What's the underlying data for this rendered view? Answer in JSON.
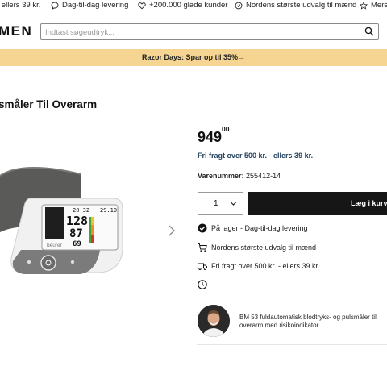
{
  "usp_bar": {
    "items": [
      {
        "label": "- ellers 39 kr.",
        "icon": "truck-icon"
      },
      {
        "label": "Dag-til-dag levering",
        "icon": "chat-bubble-icon"
      },
      {
        "label": "+200.000 glade kunder",
        "icon": "heart-icon"
      },
      {
        "label": "Nordens største udvalg til mænd",
        "icon": "verified-badge-icon"
      },
      {
        "label": "Mere",
        "icon": "star-icon"
      }
    ]
  },
  "header": {
    "logo_text": "MEN",
    "search_placeholder": "Indtast søgeudtryk...",
    "search_icon": "search-icon"
  },
  "promo": {
    "text": "Razor Days: Spar op til 35%→",
    "color": "#f6d592"
  },
  "product": {
    "title": "småler Til Overarm",
    "price_main": "949",
    "price_decimals": "00",
    "shipping_note": "Fri fragt over 500 kr. - ellers 39 kr.",
    "sku_label": "Varenummer:",
    "sku_value": "255412-14",
    "quantity": "1",
    "add_to_cart_label": "Læg i kurv",
    "info_lines": [
      {
        "text": "På lager - Dag-til-dag levering",
        "icon": "check-circle-icon"
      },
      {
        "text": "Nordens største udvalg til mænd",
        "icon": "cart-icon"
      },
      {
        "text": "Fri fragt over 500 kr. - ellers 39 kr.",
        "icon": "truck-icon"
      },
      {
        "text": "",
        "icon": "clock-icon"
      }
    ],
    "device_display": {
      "time": "20:32",
      "date": "29.10",
      "sys": "128",
      "dia": "87",
      "pulse": "69",
      "brand": "beurer"
    }
  },
  "expert": {
    "text": "BM 53 fuldautomatisk blodtryks- og pulsmåler til overarm med risikoindikator"
  },
  "colors": {
    "promo": "#f6d592",
    "button": "#161616",
    "link": "#24425f"
  }
}
